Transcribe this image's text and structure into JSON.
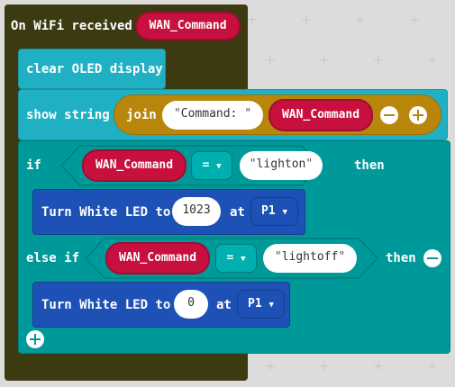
{
  "event": {
    "label": "On WiFi received",
    "param": "WAN_Command"
  },
  "clear": {
    "label": "clear OLED display"
  },
  "show": {
    "label": "show string",
    "join_label": "join",
    "string_value": "Command: ",
    "var": "WAN_Command"
  },
  "if_block": {
    "if_label": "if",
    "then_label": "then",
    "var": "WAN_Command",
    "op": "=",
    "value": "lighton",
    "action": {
      "label": "Turn White LED to",
      "value": "1023",
      "at": "at",
      "pin": "P1"
    }
  },
  "else_if": {
    "label": "else if",
    "then_label": "then",
    "var": "WAN_Command",
    "op": "=",
    "value": "lightoff",
    "action": {
      "label": "Turn White LED to",
      "value": "0",
      "at": "at",
      "pin": "P1"
    }
  },
  "colors": {
    "event": "#3c3a11",
    "basic": "#1fb0c4",
    "text": "#b8860b",
    "logic": "#009999",
    "led": "#1d51b5",
    "variable": "#c8103f"
  },
  "icons": {
    "add": "plus-circle-icon",
    "remove": "minus-circle-icon",
    "dropdown": "chevron-down-icon"
  }
}
